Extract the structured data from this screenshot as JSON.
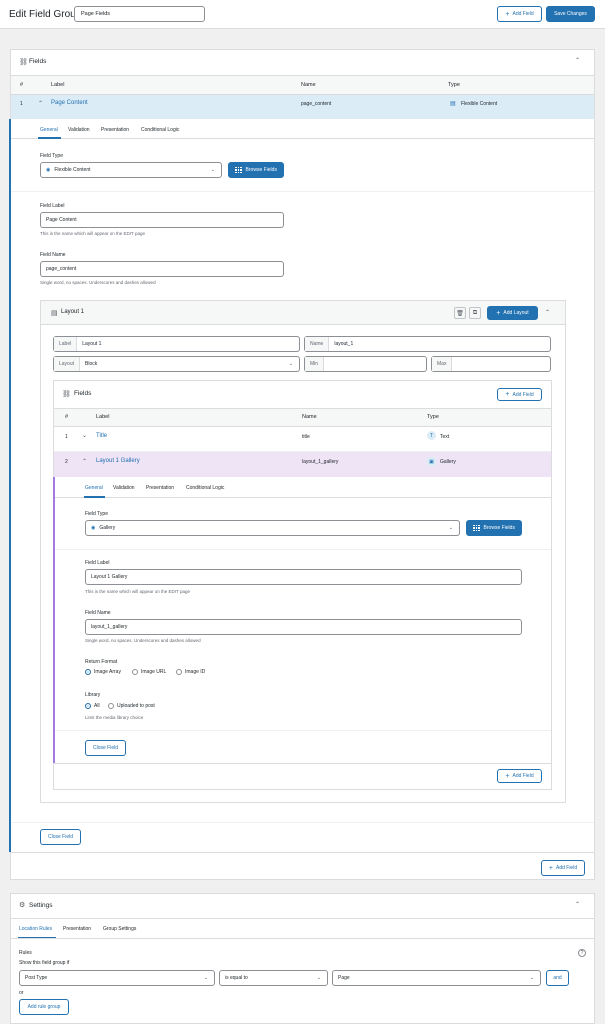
{
  "header": {
    "title": "Edit Field Group",
    "group_name": "Page Fields",
    "add_field": "Add Field",
    "save": "Save Changes"
  },
  "fields_panel": {
    "title": "Fields",
    "columns": [
      "#",
      "Label",
      "Name",
      "Type"
    ],
    "row": {
      "num": "1",
      "label": "Page Content",
      "name": "page_content",
      "type": "Flexible Content"
    },
    "tabs": [
      "General",
      "Validation",
      "Presentation",
      "Conditional Logic"
    ],
    "field_type_label": "Field Type",
    "field_type_value": "Flexible Content",
    "browse_fields": "Browse Fields",
    "field_label_label": "Field Label",
    "field_label_value": "Page Content",
    "field_label_hint": "This is the name which will appear on the EDIT page",
    "field_name_label": "Field Name",
    "field_name_value": "page_content",
    "field_name_hint": "Single word, no spaces. Underscores and dashes allowed",
    "close_field": "Close Field",
    "add_field": "Add Field"
  },
  "layout": {
    "title": "Layout 1",
    "add_layout": "Add Layout",
    "label_prefix": "Label",
    "label_value": "Layout 1",
    "name_prefix": "Name",
    "name_value": "layout_1",
    "layout_prefix": "Layout",
    "layout_value": "Block",
    "min_prefix": "Min",
    "max_prefix": "Max",
    "sub_fields": {
      "title": "Fields",
      "add_field": "Add Field",
      "columns": [
        "#",
        "Label",
        "Name",
        "Type"
      ],
      "rows": [
        {
          "num": "1",
          "label": "Title",
          "name": "title",
          "type": "Text"
        },
        {
          "num": "2",
          "label": "Layout 1 Gallery",
          "name": "layout_1_gallery",
          "type": "Gallery"
        }
      ],
      "tabs": [
        "General",
        "Validation",
        "Presentation",
        "Conditional Logic"
      ],
      "field_type_label": "Field Type",
      "field_type_value": "Gallery",
      "browse_fields": "Browse Fields",
      "field_label_label": "Field Label",
      "field_label_value": "Layout 1 Gallery",
      "field_label_hint": "This is the name which will appear on the EDIT page",
      "field_name_label": "Field Name",
      "field_name_value": "layout_1_gallery",
      "field_name_hint": "Single word, no spaces. Underscores and dashes allowed",
      "return_format_label": "Return Format",
      "return_options": [
        "Image Array",
        "Image URL",
        "Image ID"
      ],
      "library_label": "Library",
      "library_options": [
        "All",
        "Uploaded to post"
      ],
      "library_hint": "Limit the media library choice",
      "close_field": "Close Field"
    }
  },
  "settings": {
    "title": "Settings",
    "tabs": [
      "Location Rules",
      "Presentation",
      "Group Settings"
    ],
    "rules_label": "Rules",
    "show_if": "Show this field group if",
    "param": "Post Type",
    "operator": "is equal to",
    "value": "Page",
    "and": "and",
    "or": "or",
    "add_rule_group": "Add rule group"
  },
  "colors": {
    "accent": "#2271b1",
    "row_highlight": "#dcecf7",
    "sub_row_highlight": "#efe3f6",
    "sub_left_border": "#a27be0"
  }
}
